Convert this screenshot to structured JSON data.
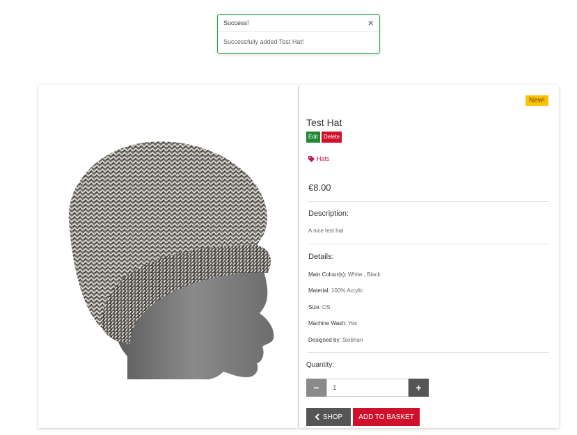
{
  "toast": {
    "title": "Success!",
    "close_glyph": "×",
    "message": "Successfully added Test Hat!",
    "accent": "#28a745"
  },
  "product": {
    "badge": "New!",
    "name": "Test Hat",
    "edit_label": "Edit",
    "delete_label": "Delete",
    "category": "Hats",
    "price": "€8.00",
    "description_title": "Description:",
    "description": "A nice test hat",
    "details_title": "Details:",
    "details": [
      {
        "label": "Main Colour(s):",
        "value": "White , Black"
      },
      {
        "label": "Material:",
        "value": "100% Acrylic"
      },
      {
        "label": "Size:",
        "value": "OS"
      },
      {
        "label": "Machine Wash:",
        "value": "Yes"
      },
      {
        "label": "Designed by:",
        "value": "Siobhan"
      }
    ],
    "quantity_label": "Quantity:",
    "quantity_value": "1",
    "minus_glyph": "−",
    "plus_glyph": "+",
    "shop_label": "SHOP",
    "basket_label": "ADD TO BASKET"
  },
  "icons": {
    "tag": "tag-icon",
    "chevron": "chevron-left-icon",
    "close": "close-icon"
  },
  "colors": {
    "success": "#28a745",
    "danger": "#d0112b",
    "warning": "#ffc107",
    "edit": "#218838",
    "dark": "#555555"
  }
}
